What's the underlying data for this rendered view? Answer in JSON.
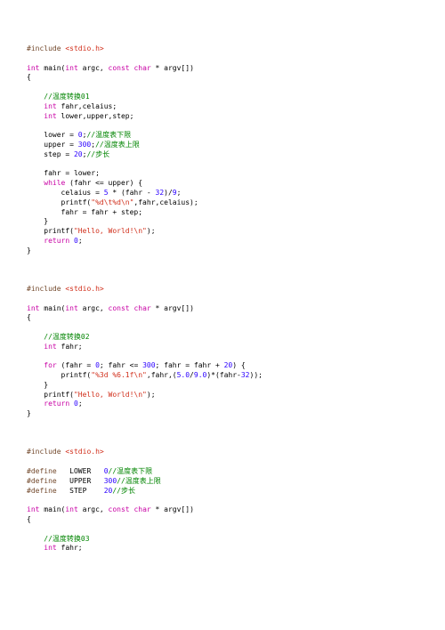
{
  "block1": {
    "l01": "#include",
    "l01b": "<stdio.h>",
    "l02a": "int",
    "l02b": " main(",
    "l02c": "int",
    "l02d": " argc, ",
    "l02e": "const",
    "l02f": " ",
    "l02g": "char",
    "l02h": " * argv[])",
    "l03": "{",
    "l04c": "//温度转换01",
    "l05a": "int",
    "l05b": " fahr,celaius;",
    "l06a": "int",
    "l06b": " lower,upper,step;",
    "l07a": "lower = ",
    "l07n": "0",
    "l07b": ";",
    "l07c": "//温度表下限",
    "l08a": "upper = ",
    "l08n": "300",
    "l08b": ";",
    "l08c": "//温度表上限",
    "l09a": "step = ",
    "l09n": "20",
    "l09b": ";",
    "l09c": "//步长",
    "l10": "fahr = lower;",
    "l11a": "while",
    "l11b": " (fahr <= upper) {",
    "l12a": "celaius = ",
    "l12n1": "5",
    "l12b": " * (fahr - ",
    "l12n2": "32",
    "l12c": ")/",
    "l12n3": "9",
    "l12d": ";",
    "l13a": "printf(",
    "l13s": "\"%d\\t%d\\n\"",
    "l13b": ",fahr,celaius);",
    "l14": "fahr = fahr + step;",
    "l15": "}",
    "l16a": "printf(",
    "l16s": "\"Hello, World!\\n\"",
    "l16b": ");",
    "l17a": "return",
    "l17n": "0",
    "l17b": ";",
    "l18": "}"
  },
  "block2": {
    "l01": "#include",
    "l01b": "<stdio.h>",
    "l02a": "int",
    "l02b": " main(",
    "l02c": "int",
    "l02d": " argc, ",
    "l02e": "const",
    "l02f": " ",
    "l02g": "char",
    "l02h": " * argv[])",
    "l03": "{",
    "l04c": "//温度转换02",
    "l05a": "int",
    "l05b": " fahr;",
    "l06a": "for",
    "l06b": " (fahr = ",
    "l06n1": "0",
    "l06c": "; fahr <= ",
    "l06n2": "300",
    "l06d": "; fahr = fahr + ",
    "l06n3": "20",
    "l06e": ") {",
    "l07a": "printf(",
    "l07s": "\"%3d %6.1f\\n\"",
    "l07b": ",fahr,(",
    "l07n1": "5.0",
    "l07c": "/",
    "l07n2": "9.0",
    "l07d": ")*(fahr-",
    "l07n3": "32",
    "l07e": "));",
    "l08": "}",
    "l09a": "printf(",
    "l09s": "\"Hello, World!\\n\"",
    "l09b": ");",
    "l10a": "return",
    "l10n": "0",
    "l10b": ";",
    "l11": "}"
  },
  "block3": {
    "l01": "#include",
    "l01b": "<stdio.h>",
    "d1a": "#define",
    "d1b": "LOWER",
    "d1n": "0",
    "d1c": "//温度表下限",
    "d2a": "#define",
    "d2b": "UPPER",
    "d2n": "300",
    "d2c": "//温度表上限",
    "d3a": "#define",
    "d3b": "STEP",
    "d3n": "20",
    "d3c": "//步长",
    "l02a": "int",
    "l02b": " main(",
    "l02c": "int",
    "l02d": " argc, ",
    "l02e": "const",
    "l02f": " ",
    "l02g": "char",
    "l02h": " * argv[])",
    "l03": "{",
    "l04c": "//温度转换03",
    "l05a": "int",
    "l05b": " fahr;"
  }
}
